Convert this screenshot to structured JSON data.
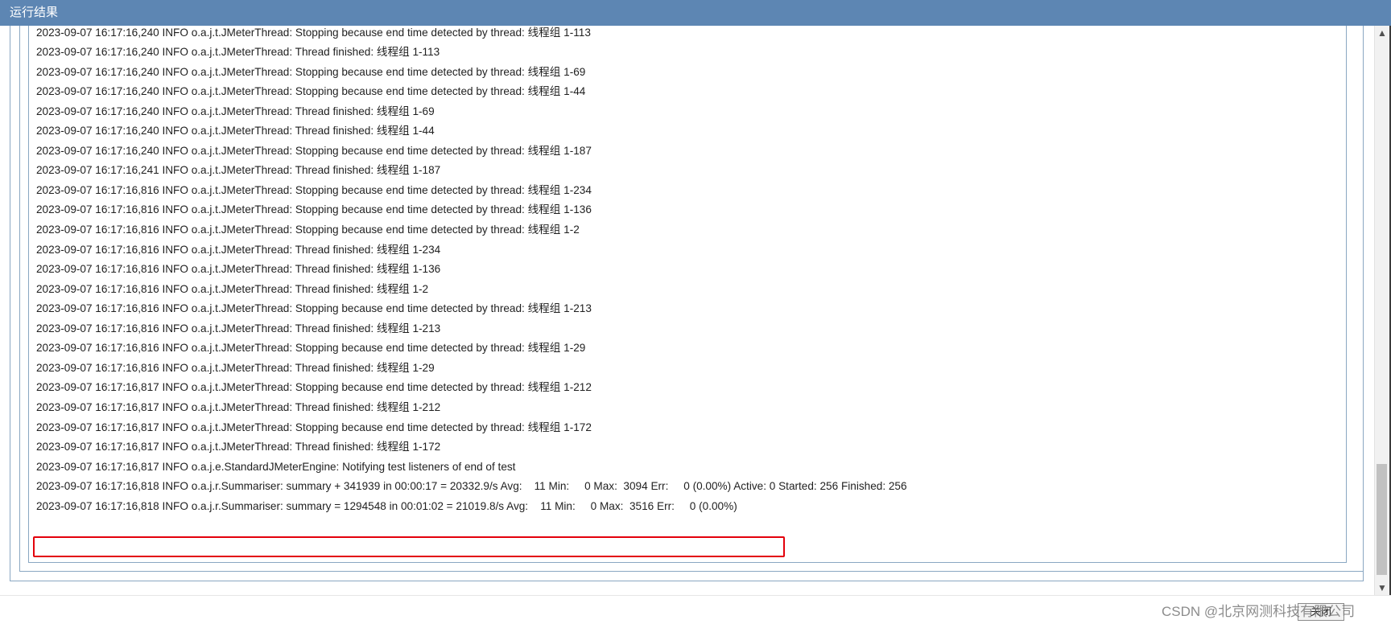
{
  "window": {
    "title": "运行结果"
  },
  "log": {
    "lines": [
      "2023-09-07 16:17:16,240 INFO o.a.j.t.JMeterThread: Stopping because end time detected by thread: 线程组 1-113",
      "2023-09-07 16:17:16,240 INFO o.a.j.t.JMeterThread: Thread finished: 线程组 1-113",
      "2023-09-07 16:17:16,240 INFO o.a.j.t.JMeterThread: Stopping because end time detected by thread: 线程组 1-69",
      "2023-09-07 16:17:16,240 INFO o.a.j.t.JMeterThread: Stopping because end time detected by thread: 线程组 1-44",
      "2023-09-07 16:17:16,240 INFO o.a.j.t.JMeterThread: Thread finished: 线程组 1-69",
      "2023-09-07 16:17:16,240 INFO o.a.j.t.JMeterThread: Thread finished: 线程组 1-44",
      "2023-09-07 16:17:16,240 INFO o.a.j.t.JMeterThread: Stopping because end time detected by thread: 线程组 1-187",
      "2023-09-07 16:17:16,241 INFO o.a.j.t.JMeterThread: Thread finished: 线程组 1-187",
      "2023-09-07 16:17:16,816 INFO o.a.j.t.JMeterThread: Stopping because end time detected by thread: 线程组 1-234",
      "2023-09-07 16:17:16,816 INFO o.a.j.t.JMeterThread: Stopping because end time detected by thread: 线程组 1-136",
      "2023-09-07 16:17:16,816 INFO o.a.j.t.JMeterThread: Stopping because end time detected by thread: 线程组 1-2",
      "2023-09-07 16:17:16,816 INFO o.a.j.t.JMeterThread: Thread finished: 线程组 1-234",
      "2023-09-07 16:17:16,816 INFO o.a.j.t.JMeterThread: Thread finished: 线程组 1-136",
      "2023-09-07 16:17:16,816 INFO o.a.j.t.JMeterThread: Thread finished: 线程组 1-2",
      "2023-09-07 16:17:16,816 INFO o.a.j.t.JMeterThread: Stopping because end time detected by thread: 线程组 1-213",
      "2023-09-07 16:17:16,816 INFO o.a.j.t.JMeterThread: Thread finished: 线程组 1-213",
      "2023-09-07 16:17:16,816 INFO o.a.j.t.JMeterThread: Stopping because end time detected by thread: 线程组 1-29",
      "2023-09-07 16:17:16,816 INFO o.a.j.t.JMeterThread: Thread finished: 线程组 1-29",
      "2023-09-07 16:17:16,817 INFO o.a.j.t.JMeterThread: Stopping because end time detected by thread: 线程组 1-212",
      "2023-09-07 16:17:16,817 INFO o.a.j.t.JMeterThread: Thread finished: 线程组 1-212",
      "2023-09-07 16:17:16,817 INFO o.a.j.t.JMeterThread: Stopping because end time detected by thread: 线程组 1-172",
      "2023-09-07 16:17:16,817 INFO o.a.j.t.JMeterThread: Thread finished: 线程组 1-172",
      "2023-09-07 16:17:16,817 INFO o.a.j.e.StandardJMeterEngine: Notifying test listeners of end of test",
      "2023-09-07 16:17:16,818 INFO o.a.j.r.Summariser: summary + 341939 in 00:00:17 = 20332.9/s Avg:    11 Min:     0 Max:  3094 Err:     0 (0.00%) Active: 0 Started: 256 Finished: 256",
      "2023-09-07 16:17:16,818 INFO o.a.j.r.Summariser: summary = 1294548 in 00:01:02 = 21019.8/s Avg:    11 Min:     0 Max:  3516 Err:     0 (0.00%)"
    ]
  },
  "footer": {
    "close_label": "关闭",
    "watermark": "CSDN @北京网测科技有限公司"
  },
  "colors": {
    "title_bar": "#5d86b3",
    "highlight": "#e3000b"
  }
}
